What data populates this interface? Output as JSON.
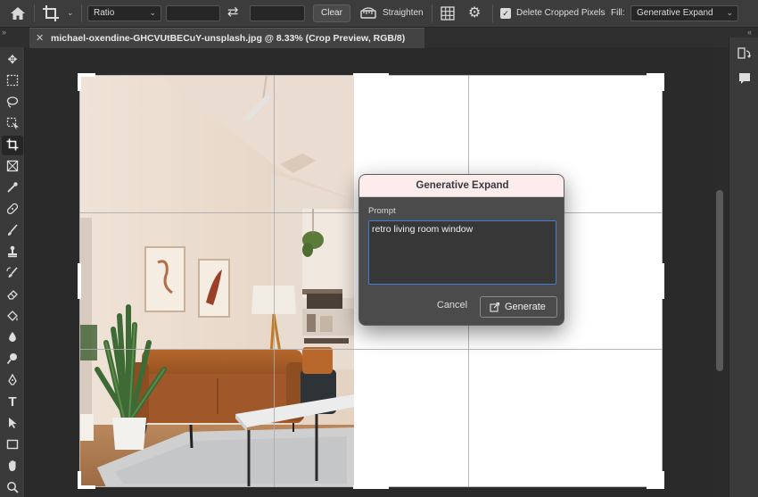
{
  "options_bar": {
    "ratio_label": "Ratio",
    "clear_label": "Clear",
    "straighten_label": "Straighten",
    "delete_cropped_label": "Delete Cropped Pixels",
    "delete_cropped_checked": true,
    "fill_label": "Fill:",
    "fill_value": "Generative Expand"
  },
  "document_tab": {
    "title": "michael-oxendine-GHCVUtBECuY-unsplash.jpg @ 8.33% (Crop Preview, RGB/8)"
  },
  "dialog": {
    "title": "Generative Expand",
    "prompt_label": "Prompt",
    "prompt_value": "retro living room window",
    "cancel_label": "Cancel",
    "generate_label": "Generate"
  },
  "icons": {
    "home": "home-icon",
    "crop": "crop-icon",
    "swap": "swap-icon",
    "straighten": "straighten-icon",
    "overlay_grid": "overlay-grid-icon",
    "settings": "gear-icon",
    "generate": "generate-icon"
  },
  "colors": {
    "accent_focus": "#3d7fd9",
    "dialog_header": "#fdecec"
  }
}
